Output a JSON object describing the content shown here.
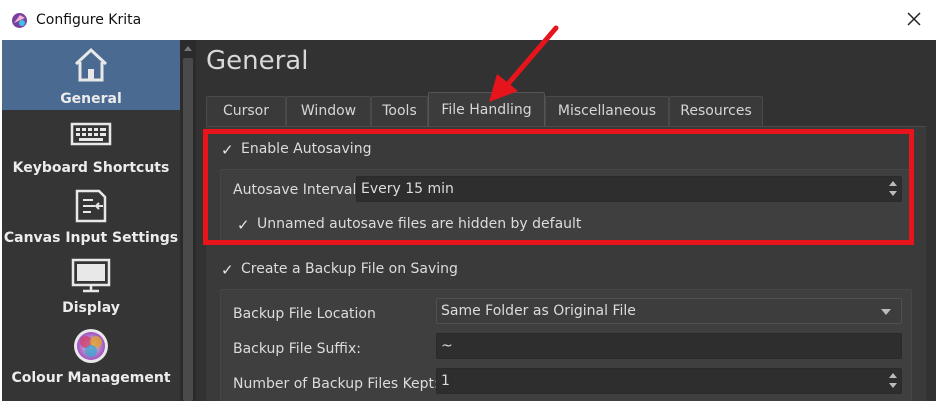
{
  "window": {
    "title": "Configure Krita"
  },
  "sidebar": {
    "items": [
      {
        "label": "General",
        "icon": "home-icon",
        "active": true
      },
      {
        "label": "Keyboard Shortcuts",
        "icon": "keyboard-icon"
      },
      {
        "label": "Canvas Input Settings",
        "icon": "canvas-input-icon"
      },
      {
        "label": "Display",
        "icon": "monitor-icon"
      },
      {
        "label": "Colour Management",
        "icon": "colour-wheel-icon"
      }
    ]
  },
  "page": {
    "title": "General"
  },
  "tabs": [
    {
      "label": "Cursor"
    },
    {
      "label": "Window"
    },
    {
      "label": "Tools"
    },
    {
      "label": "File Handling",
      "active": true
    },
    {
      "label": "Miscellaneous"
    },
    {
      "label": "Resources"
    }
  ],
  "autosave": {
    "enable_label": "Enable Autosaving",
    "enabled": true,
    "interval_label": "Autosave Interval:",
    "interval_value": "Every 15 min",
    "hidden_label": "Unnamed autosave files are hidden by default",
    "hidden_checked": true
  },
  "backup": {
    "create_label": "Create a Backup File on Saving",
    "create_checked": true,
    "location_label": "Backup File Location",
    "location_value": "Same Folder as Original File",
    "suffix_label": "Backup File Suffix:",
    "suffix_value": "~",
    "count_label": "Number of Backup Files Kept:",
    "count_value": "1"
  },
  "colors": {
    "highlight": "#e8141c",
    "accent": "#4a6a92"
  }
}
